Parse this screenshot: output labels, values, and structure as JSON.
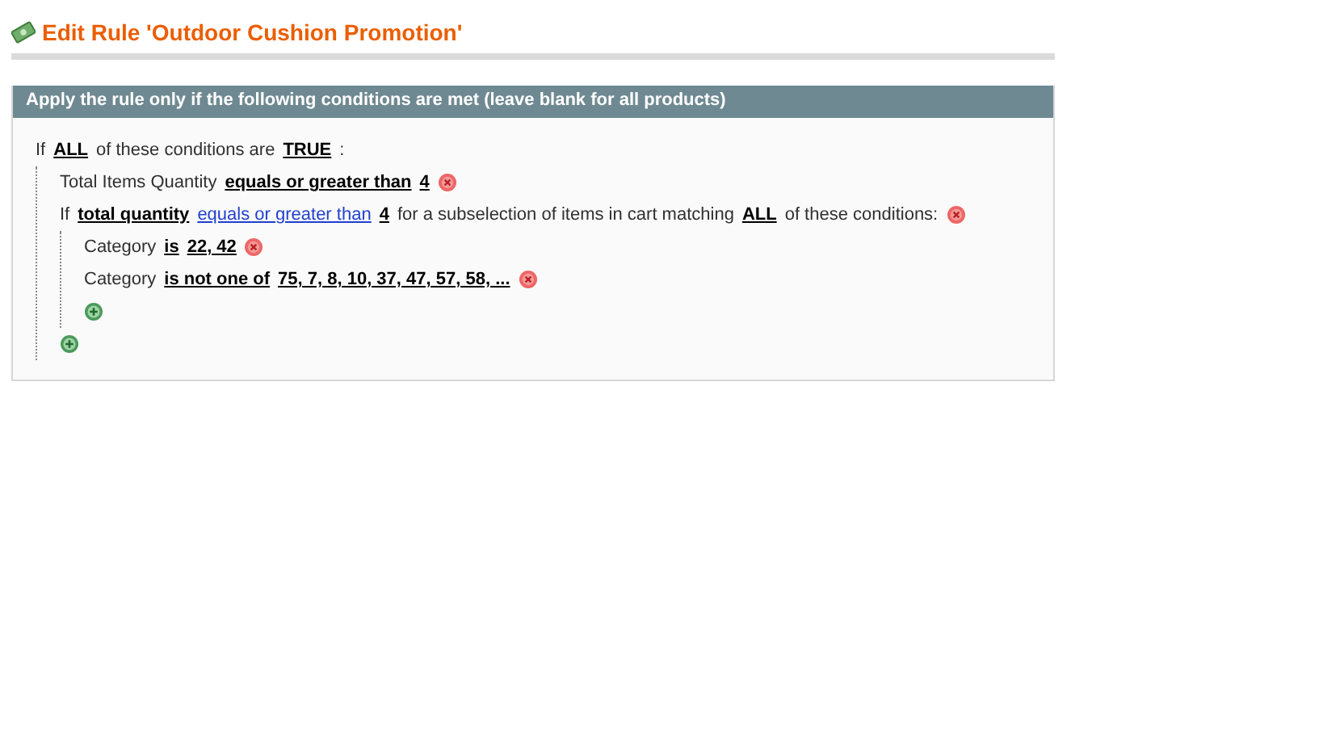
{
  "page_title": "Edit Rule 'Outdoor Cushion Promotion'",
  "panel": {
    "heading": "Apply the rule only if the following conditions are met (leave blank for all products)",
    "root": {
      "removable": false,
      "parts": [
        {
          "kind": "text",
          "text": "If"
        },
        {
          "kind": "value",
          "text": "ALL"
        },
        {
          "kind": "text",
          "text": "of these conditions are"
        },
        {
          "kind": "value",
          "text": "TRUE"
        },
        {
          "kind": "text",
          "text": ":"
        }
      ],
      "children": [
        {
          "removable": true,
          "parts": [
            {
              "kind": "text",
              "text": "Total Items Quantity"
            },
            {
              "kind": "value",
              "text": "equals or greater than"
            },
            {
              "kind": "value",
              "text": "4"
            }
          ]
        },
        {
          "removable": true,
          "parts": [
            {
              "kind": "text",
              "text": "If"
            },
            {
              "kind": "value",
              "text": "total quantity"
            },
            {
              "kind": "choice",
              "text": "equals or greater than"
            },
            {
              "kind": "value",
              "text": "4"
            },
            {
              "kind": "text",
              "text": "for a subselection of items in cart matching"
            },
            {
              "kind": "value",
              "text": "ALL"
            },
            {
              "kind": "text",
              "text": "of these conditions:"
            }
          ],
          "children": [
            {
              "removable": true,
              "parts": [
                {
                  "kind": "text",
                  "text": "Category"
                },
                {
                  "kind": "value",
                  "text": "is"
                },
                {
                  "kind": "value",
                  "text": "22, 42"
                }
              ]
            },
            {
              "removable": true,
              "parts": [
                {
                  "kind": "text",
                  "text": "Category"
                },
                {
                  "kind": "value",
                  "text": "is not one of"
                },
                {
                  "kind": "value",
                  "text": "75, 7, 8, 10, 37, 47, 57, 58, ..."
                }
              ]
            }
          ]
        }
      ]
    }
  }
}
